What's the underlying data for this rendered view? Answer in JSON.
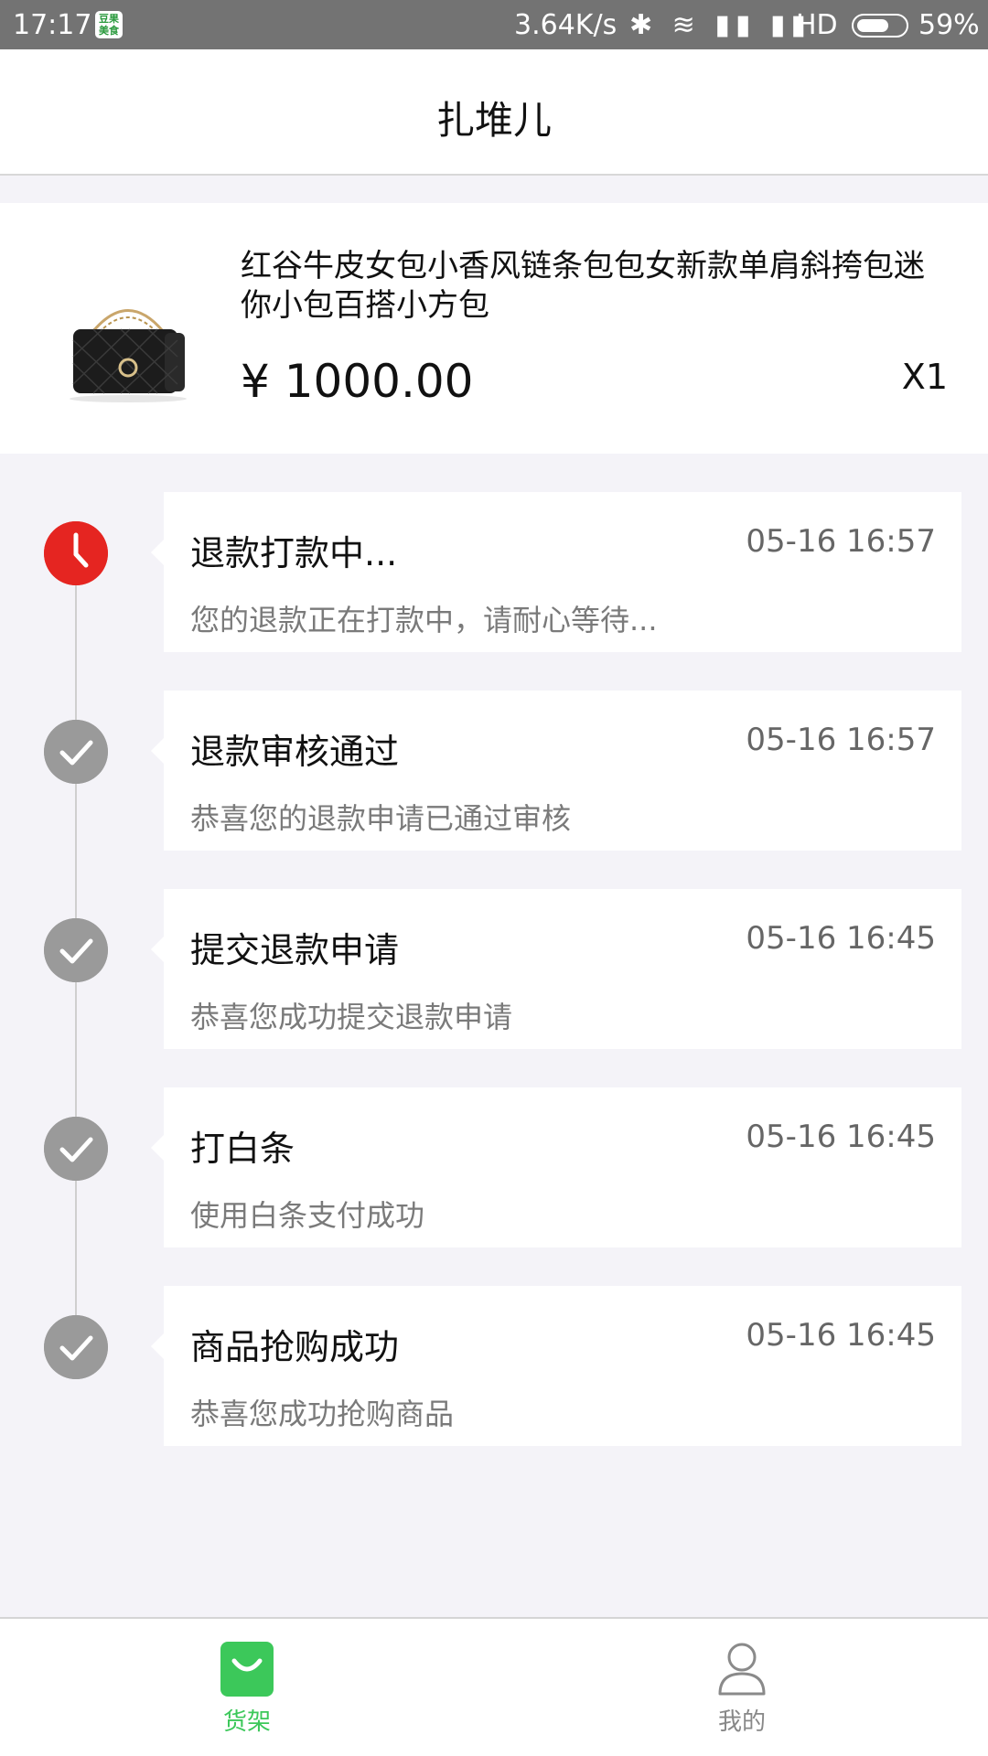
{
  "status_bar": {
    "time": "17:17",
    "app_badge": "豆果美食",
    "network_speed": "3.64K/s",
    "signal_icons": "✱ ≋ ▮▮ ▮▮",
    "hd": "HD",
    "battery_percent": "59%"
  },
  "header": {
    "title": "扎堆儿"
  },
  "product": {
    "name": "红谷牛皮女包小香风链条包包女新款单肩斜挎包迷你小包百搭小方包",
    "price": "¥ 1000.00",
    "quantity": "X1",
    "thumb_icon": "handbag-icon"
  },
  "timeline": [
    {
      "status": "active",
      "title": "退款打款中...",
      "time": "05-16 16:57",
      "desc": "您的退款正在打款中，请耐心等待..."
    },
    {
      "status": "done",
      "title": "退款审核通过",
      "time": "05-16 16:57",
      "desc": "恭喜您的退款申请已通过审核"
    },
    {
      "status": "done",
      "title": "提交退款申请",
      "time": "05-16 16:45",
      "desc": "恭喜您成功提交退款申请"
    },
    {
      "status": "done",
      "title": "打白条",
      "time": "05-16 16:45",
      "desc": "使用白条支付成功"
    },
    {
      "status": "done",
      "title": "商品抢购成功",
      "time": "05-16 16:45",
      "desc": "恭喜您成功抢购商品"
    }
  ],
  "bottom_nav": {
    "shelf_label": "货架",
    "mine_label": "我的",
    "active_color": "#3cc85a",
    "inactive_color": "#888888"
  },
  "colors": {
    "active_node": "#e52521",
    "done_node": "#9a9a9a",
    "background": "#f4f3f8"
  }
}
